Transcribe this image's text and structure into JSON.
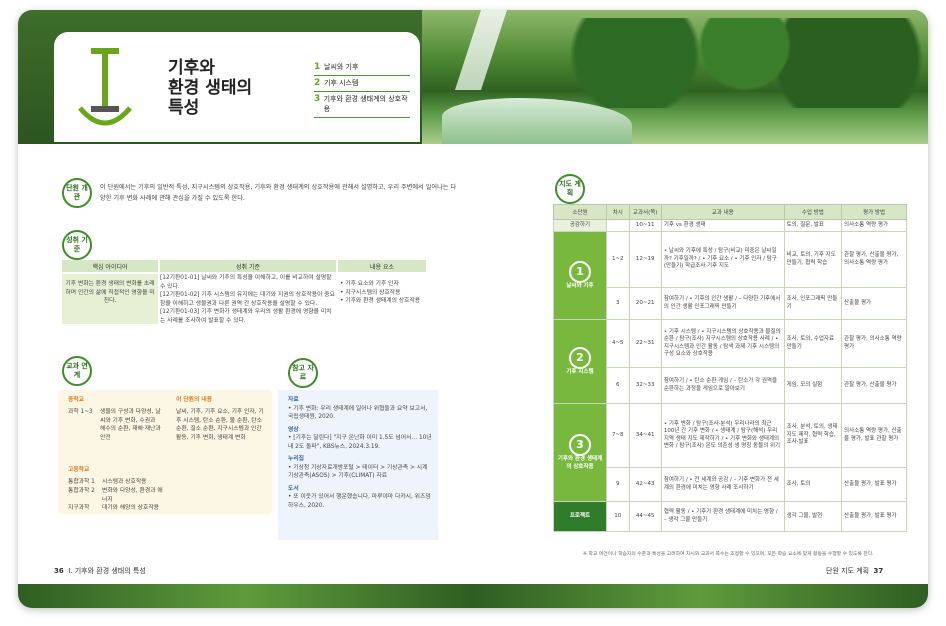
{
  "chapter": {
    "title_line1": "기후와",
    "title_line2": "환경 생태의",
    "title_line3": "특성",
    "big_letter": "I",
    "toc": [
      {
        "num": "1",
        "label": "날씨와 기후"
      },
      {
        "num": "2",
        "label": "기후 시스템"
      },
      {
        "num": "3",
        "label": "기후와 환경 생태계의 상호작용"
      }
    ]
  },
  "left_page": {
    "tag_unit": "단원 개관",
    "intro_text": "이 단원에서는 기후의 일반적 특성, 지구시스템의 상호작용, 기후와 환경 생태계의 상호작용에 관해서 설명하고, 우리 주변에서 일어나는 다양한 기후 변화 사례에 관해 관심을 가질 수 있도록 한다.",
    "tag_standard": "성취 기준",
    "std_headers": [
      "핵심 아이디어",
      "성취 기준",
      "내용 요소"
    ],
    "std_idea": "기후 변화는 환경 생태의 변화를 초래하며 인간의 삶에 직접적인 영향을 미친다.",
    "std_items": [
      "[12기환01-01] 날씨와 기후의 특성을 이해하고, 이를 비교하여 설명할 수 있다.",
      "[12기환01-02] 기후 시스템의 유지에는 대기와 지권의 상호작용이 중요함을 이해하고 생물권과 다른 권역 간 상호작용을 설명할 수 있다.",
      "[12기환01-03] 기후 변화가 생태계와 우리의 생활 환경에 영향을 미치는 사례를 조사하여 발표할 수 있다."
    ],
    "std_elements": [
      "• 기후 요소와 기후 인자",
      "• 지구시스템의 상호작용",
      "• 기후와 환경 생태계의 상호작용"
    ],
    "tag_link": "교과 연계",
    "link_middle_label": "중학교",
    "link_middle_items": [
      {
        "grade": "과학 1~3",
        "text": "생물의 구성과 다양성, 날씨와 기후 변화, 수권과 해수의 순환, 재해·재난과 안전"
      }
    ],
    "link_high_label": "고등학교",
    "link_high_items": [
      {
        "grade": "통합과학 1",
        "text": "시스템과 상호작용"
      },
      {
        "grade": "통합과학 2",
        "text": "변화와 다양성, 환경과 에너지"
      },
      {
        "grade": "지구과학",
        "text": "대기와 해양의 상호작용"
      }
    ],
    "link_other_label": "이 단원의 내용",
    "link_other_text": "날씨, 기후, 기후 요소, 기후 인자, 기후 시스템, 탄소 순환, 물 순환, 탄소 순환, 질소 순환, 지구시스템과 인간 활동, 기후 변화, 생태계 변화",
    "tag_ref": "참고 자료",
    "ref_sections": [
      {
        "head": "자료",
        "text": "• 기후 변화: 우리 생태계에 일어나 위협들과 요약 보고서, 국립생태원, 2020."
      },
      {
        "head": "영상",
        "text": "• [기후는 달린다] \"지구 온난화 이미 1.5도 넘어서… 10년 내 2도 돌파\", KBS뉴스, 2024.3.19."
      },
      {
        "head": "누리집",
        "text": "• 기상청 기상자료개방포털 > 테이터 > 기상관측 > 시계기상관측(ASOS) > 기후(CLIMAT) 자료"
      },
      {
        "head": "도서",
        "text": "• 또 이웃가 있어서 행운했습니다, 마루야마 다카시, 위즈덤하우스, 2020."
      }
    ],
    "page_no": "36",
    "footer_text": "I. 기후와 환경 생태의 특성"
  },
  "right_page": {
    "tag_plan": "지도 계획",
    "headers": [
      "소단원",
      "차시",
      "교과서(쪽)",
      "교과 내용",
      "수업 방법",
      "평가 방법"
    ],
    "rows": [
      {
        "unit": "공감하기",
        "period": "",
        "pages": "10~11",
        "content": "기후 vs 환경 생태",
        "method": "토의, 질문, 발표",
        "eval": "의사소통 역량 평가"
      },
      {
        "unit": "1",
        "unit_label": "날씨와 기후",
        "period": "1~2",
        "pages": "12~19",
        "content": "• 날씨와 기후에 특성 / 탐구(비교) 미중은 날씨일까? 기후일까? / • 기후 요소 / • 기후 인자 / 탐구(만들기) 학급조사 기후 지도",
        "method": "비교, 토의, 기후 지도 만들기, 협력 학습",
        "eval": "관찰 평가, 산출물 평가, 의사소통 역량 평가"
      },
      {
        "unit": "",
        "period": "3",
        "pages": "20~21",
        "content": "참여하기 / • 기후의 인간 생활 / – 다양한 기후에서의 인간 생활 인포그래픽 만들기",
        "method": "조사, 인포그래픽 만들기",
        "eval": "산출물 평가"
      },
      {
        "unit": "2",
        "unit_label": "기후 시스템",
        "period": "4~5",
        "pages": "22~31",
        "content": "• 기후 시스템 / • 지구시스템의 상호작용과 물질의 순환 / 탐구(조사) 지구시스템의 상호작용 사례 / • 지구시스템과 인간 활동 / 탐색 과제 기후 시스템의 구성 요소와 상호작용",
        "method": "조사, 토의, 수업자료 만들기",
        "eval": "관찰 평가, 의사소통 역량 평가"
      },
      {
        "unit": "",
        "period": "6",
        "pages": "32~33",
        "content": "참여하기 / • 탄소 순환 게임 / – 탄소가 각 권역을 순환하는 과정을 게임으로 알아보기",
        "method": "게임, 모의 실험",
        "eval": "관찰 평가, 산출물 평가"
      },
      {
        "unit": "3",
        "unit_label": "기후와 환경 생태계의 상호작용",
        "period": "7~8",
        "pages": "34~41",
        "content": "• 기후 변화 / 탐구(조사·분석) 우리나라의 최근 100년 간 기후 변화 / • 생태계 / 탐구(해석) 우리 지역 생태 지도 제작하기 / • 기후 변화와 생태계의 변화 / 탐구(조사) 온도 의존성 생 명칭 동물의 위기",
        "method": "조사, 분석, 토의, 생태 지도 제작, 협력 학습, 조사·발표",
        "eval": "의사소통 역량 평가, 산출물 평가, 발표 관찰 평가"
      },
      {
        "unit": "",
        "period": "9",
        "pages": "42~43",
        "content": "참여하기 / • 전 세계와 공감 / – 기후 변화가 전 세계의 환경에 미치는 영향 사례 조사하기",
        "method": "조사, 토의",
        "eval": "산출물 평가, 발표 평가"
      },
      {
        "unit": "프로젝트",
        "period": "10",
        "pages": "44~45",
        "content": "협력 활동 / • 기후가 환경 생태계에 미치는 영향 / – 생각 그물 만들기",
        "method": "생각 그물, 발현",
        "eval": "산출물 평가, 발표 평가"
      }
    ],
    "note": "※ 학교 여건이나 학습자의 수준과 특성을 고려하여 차시와 교과서 쪽수는 조정할 수 있으며, 모든 학습 요소에 맞게 활동을 수행할 수 있도록 한다.",
    "page_no": "37",
    "footer_text": "단원 지도 계획"
  }
}
